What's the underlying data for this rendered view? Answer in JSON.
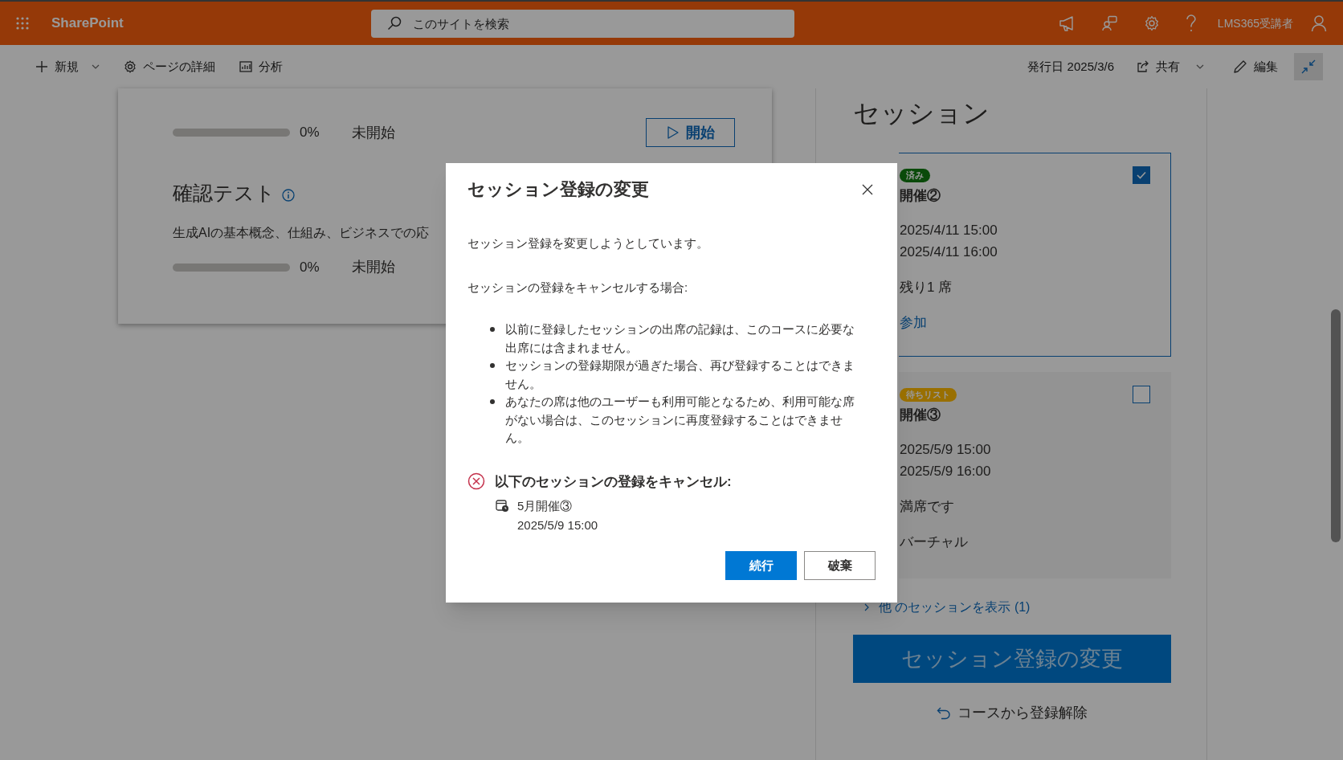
{
  "top_bar": {
    "app_name": "SharePoint",
    "search": {
      "placeholder": "このサイトを検索"
    },
    "user_name": "LMS365受講者"
  },
  "command_bar": {
    "actions": [
      {
        "label": "新規",
        "kind": "new"
      },
      {
        "label": "ページの詳細",
        "kind": "details"
      },
      {
        "label": "分析",
        "kind": "analytics"
      }
    ],
    "published": "発行日 2025/3/6",
    "share": "共有",
    "edit": "編集"
  },
  "content": {
    "items": [
      {
        "level": 0,
        "percent": "0%",
        "status": "未開始",
        "action": "開始"
      },
      {
        "title": "確認テスト",
        "description": "生成AIの基本概念、仕組み、ビジネスでの応",
        "level": 0,
        "percent": "0%",
        "status": "未開始"
      }
    ]
  },
  "sessions": {
    "title": "セッション",
    "cards": [
      {
        "badge": "済み",
        "color": "#0a4a0a",
        "name": "開催②",
        "selected": true,
        "lines": [
          {
            "kind": "text",
            "text": "2025/4/11 15:00"
          },
          {
            "kind": "text",
            "text": "2025/4/11 16:00"
          },
          {
            "kind": "gap"
          },
          {
            "kind": "text",
            "text": "残り1 席"
          },
          {
            "kind": "gap"
          },
          {
            "kind": "link",
            "text": "参加"
          }
        ]
      },
      {
        "badge": "待ちリスト",
        "color": "#996f00",
        "name": "開催③",
        "selected": false,
        "lines": [
          {
            "kind": "text",
            "text": "2025/5/9 15:00"
          },
          {
            "kind": "text",
            "text": "2025/5/9 16:00"
          },
          {
            "kind": "gap"
          },
          {
            "kind": "text",
            "text": "満席です"
          },
          {
            "kind": "gap"
          },
          {
            "kind": "text",
            "text": "バーチャル"
          }
        ]
      }
    ],
    "more_link": "他 のセッションを表示 (1)",
    "change_button": "セッション登録の変更",
    "unenroll": "コースから登録解除"
  },
  "dialog": {
    "title": "セッション登録の変更",
    "intro": "セッション登録を変更しようとしています。",
    "subhead": "セッションの登録をキャンセルする場合:",
    "bullets": [
      "以前に登録したセッションの出席の記録は、このコースに必要な出席には含まれません。",
      "セッションの登録期限が過ぎた場合、再び登録することはできません。",
      "あなたの席は他のユーザーも利用可能となるため、利用可能な席がない場合は、このセッションに再度登録することはできません。"
    ],
    "cancel_heading": "以下のセッションの登録をキャンセル:",
    "session_name": "5月開催③",
    "session_time": "2025/5/9 15:00",
    "buttons": [
      {
        "label": "続行",
        "kind": "primary"
      },
      {
        "label": "破棄",
        "kind": "secondary"
      }
    ]
  }
}
